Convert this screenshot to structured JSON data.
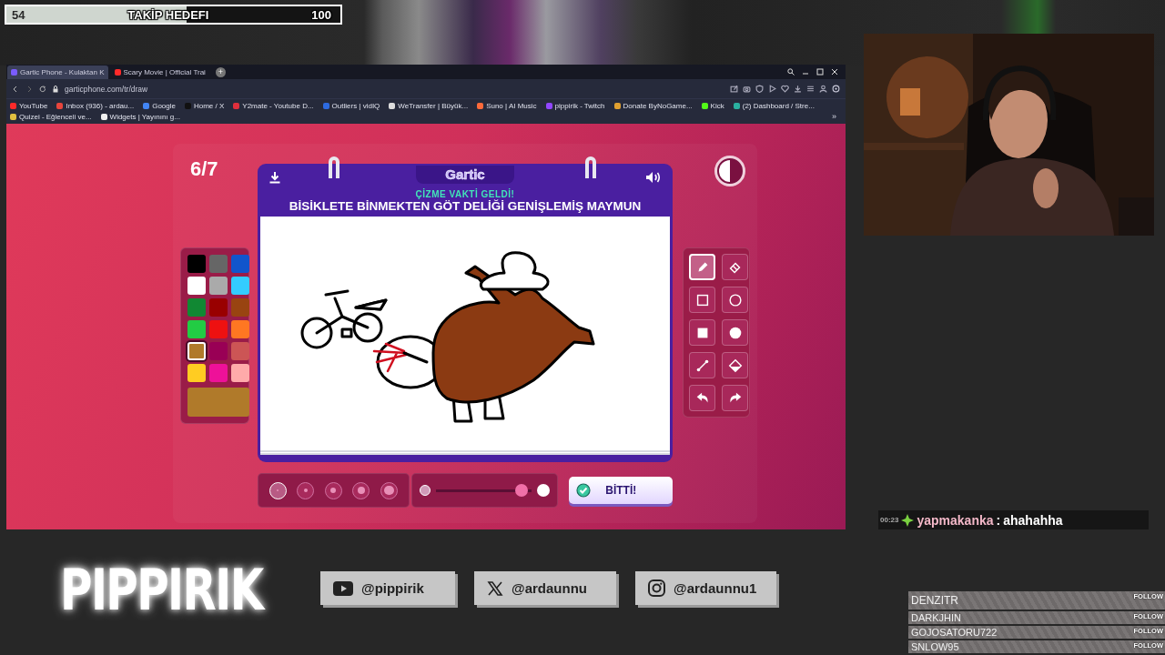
{
  "follow_goal": {
    "current": "54",
    "label": "TAKİP HEDEFI",
    "target": "100",
    "level": 0.54
  },
  "browser": {
    "tabs": [
      {
        "label": "Gartic Phone - Kulaktan K",
        "color": "#7a5cff",
        "selected": true
      },
      {
        "label": "Scary Movie | Official Trai",
        "color": "#ff2a2a",
        "selected": false
      }
    ],
    "new_tab": "+",
    "url": "garticphone.com/tr/draw",
    "bookmarks": [
      {
        "label": "YouTube",
        "color": "#ff2a2a"
      },
      {
        "label": "Inbox (936) - ardau...",
        "color": "#e8453c"
      },
      {
        "label": "Google",
        "color": "#4285f4"
      },
      {
        "label": "Home / X",
        "color": "#111111"
      },
      {
        "label": "Y2mate - Youtube D...",
        "color": "#e02f3c"
      },
      {
        "label": "Outliers | vidIQ",
        "color": "#2d6ae0"
      },
      {
        "label": "WeTransfer | Büyük...",
        "color": "#dddddd"
      },
      {
        "label": "Suno | AI Music",
        "color": "#ff6a3a"
      },
      {
        "label": "pippirik - Twitch",
        "color": "#9146ff"
      },
      {
        "label": "Donate ByNoGame...",
        "color": "#e0a030"
      },
      {
        "label": "Kick",
        "color": "#53fc18"
      },
      {
        "label": "(2) Dashboard / Stre...",
        "color": "#2ab0a0"
      },
      {
        "label": "Quizei - Eğlenceli ve...",
        "color": "#e0c040"
      },
      {
        "label": "Widgets | Yayınını g...",
        "color": "#f0f0f0"
      }
    ],
    "overflow": "»"
  },
  "game": {
    "round": "6/7",
    "logo": "Gartic",
    "subtitle": "ÇİZME VAKTİ GELDİ!",
    "prompt": "BİSİKLETE BİNMEKTEN GÖT DELİĞİ GENİŞLEMİŞ MAYMUN",
    "palette": [
      {
        "color": "#000000",
        "selected": false
      },
      {
        "color": "#666666",
        "selected": false
      },
      {
        "color": "#1155cc",
        "selected": false
      },
      {
        "color": "#ffffff",
        "selected": false
      },
      {
        "color": "#aaaaaa",
        "selected": false
      },
      {
        "color": "#33ccff",
        "selected": false
      },
      {
        "color": "#118833",
        "selected": false
      },
      {
        "color": "#990000",
        "selected": false
      },
      {
        "color": "#994411",
        "selected": false
      },
      {
        "color": "#22cc44",
        "selected": false
      },
      {
        "color": "#ee1111",
        "selected": false
      },
      {
        "color": "#ff7722",
        "selected": false
      },
      {
        "color": "#b07a2a",
        "selected": true
      },
      {
        "color": "#990055",
        "selected": false
      },
      {
        "color": "#cc5555",
        "selected": false
      },
      {
        "color": "#ffcc22",
        "selected": false
      },
      {
        "color": "#ee1199",
        "selected": false
      },
      {
        "color": "#ffaaaa",
        "selected": false
      }
    ],
    "tools": [
      {
        "kind": "pen",
        "selected": true
      },
      {
        "kind": "eraser",
        "selected": false
      },
      {
        "kind": "rect",
        "selected": false
      },
      {
        "kind": "ellipse",
        "selected": false
      },
      {
        "kind": "filled-rect",
        "selected": false
      },
      {
        "kind": "filled-ellipse",
        "selected": false
      },
      {
        "kind": "line",
        "selected": false
      },
      {
        "kind": "fill",
        "selected": false
      },
      {
        "kind": "undo",
        "selected": false
      },
      {
        "kind": "redo",
        "selected": false
      }
    ],
    "brush_sizes": [
      {
        "selected": true
      },
      {
        "selected": false
      },
      {
        "selected": false
      },
      {
        "selected": false
      },
      {
        "selected": false
      }
    ],
    "opacity": {
      "level": 0.95
    },
    "done_button": "BİTTİ!"
  },
  "chat": [
    {
      "time": "00:23",
      "user": "yapmakanka",
      "separator": ":",
      "message": "ahahahha"
    }
  ],
  "followers": [
    {
      "name": "DENZITR",
      "action": "FOLLOW"
    },
    {
      "name": "DARKJHIN",
      "action": "FOLLOW"
    },
    {
      "name": "GOJOSATORU722",
      "action": "FOLLOW"
    },
    {
      "name": "SNLOW95",
      "action": "FOLLOW"
    }
  ],
  "brand": "PIPPIRIK",
  "socials": [
    {
      "kind": "youtube",
      "handle": "@pippirik"
    },
    {
      "kind": "x",
      "handle": "@ardaunnu"
    },
    {
      "kind": "instagram",
      "handle": "@ardaunnu1"
    }
  ]
}
